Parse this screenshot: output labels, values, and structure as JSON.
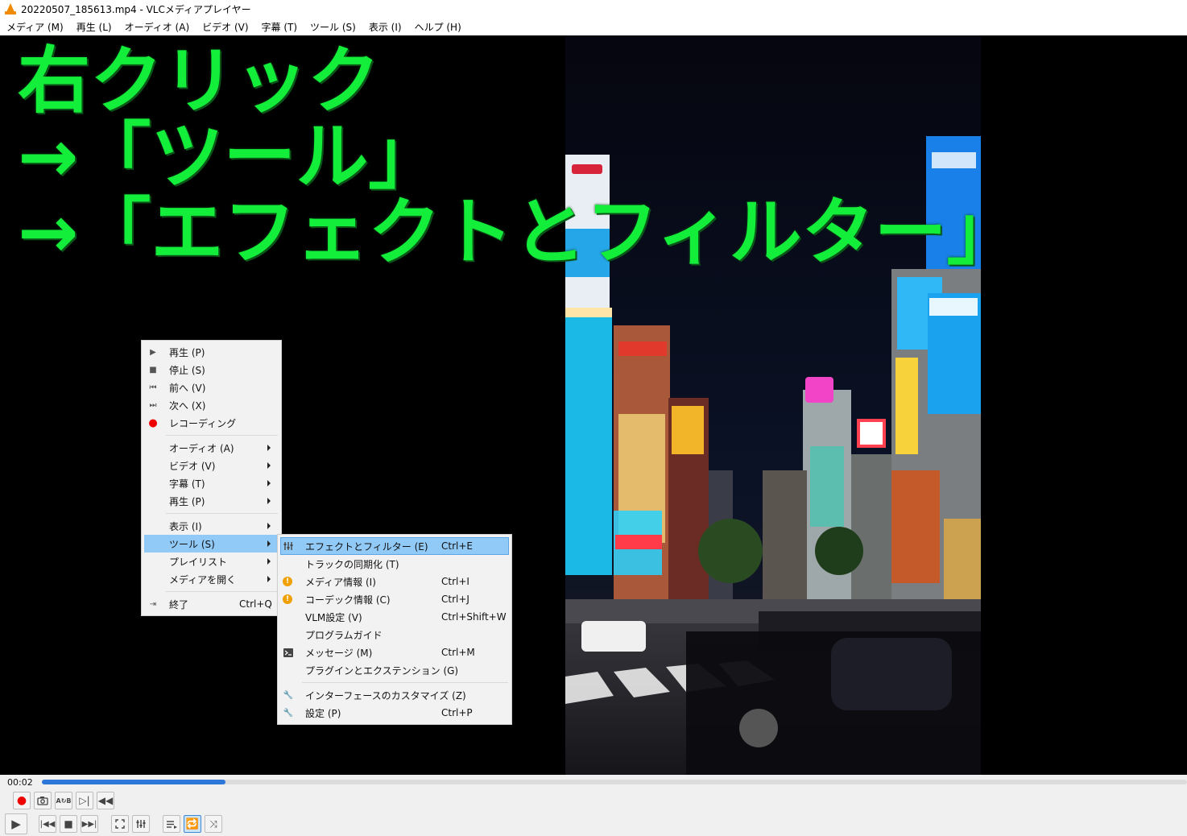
{
  "window": {
    "title": "20220507_185613.mp4 - VLCメディアプレイヤー"
  },
  "menubar": [
    {
      "label": "メディア (M)"
    },
    {
      "label": "再生 (L)"
    },
    {
      "label": "オーディオ (A)"
    },
    {
      "label": "ビデオ (V)"
    },
    {
      "label": "字幕 (T)"
    },
    {
      "label": "ツール (S)"
    },
    {
      "label": "表示 (I)"
    },
    {
      "label": "ヘルプ (H)"
    }
  ],
  "overlay": {
    "color": "#13ee3a",
    "lines": [
      "右クリック",
      "→「ツール」",
      "→「エフェクトとフィルター」"
    ]
  },
  "context_menu": {
    "items": [
      {
        "label": "再生 (P)",
        "icon": "play-icon"
      },
      {
        "label": "停止 (S)",
        "icon": "stop-icon"
      },
      {
        "label": "前へ (V)",
        "icon": "previous-icon"
      },
      {
        "label": "次へ (X)",
        "icon": "next-icon"
      },
      {
        "label": "レコーディング",
        "icon": "record-icon"
      },
      {
        "label": "オーディオ (A)",
        "submenu": true
      },
      {
        "label": "ビデオ (V)",
        "submenu": true
      },
      {
        "label": "字幕 (T)",
        "submenu": true
      },
      {
        "label": "再生 (P)",
        "submenu": true
      },
      {
        "label": "表示 (I)",
        "submenu": true
      },
      {
        "label": "ツール (S)",
        "submenu": true,
        "highlighted": true
      },
      {
        "label": "プレイリスト",
        "submenu": true
      },
      {
        "label": "メディアを開く",
        "submenu": true
      },
      {
        "label": "終了",
        "shortcut": "Ctrl+Q",
        "icon": "exit-icon"
      }
    ]
  },
  "tools_submenu": {
    "items": [
      {
        "label": "エフェクトとフィルター (E)",
        "shortcut": "Ctrl+E",
        "icon": "equalizer-icon",
        "highlighted": true
      },
      {
        "label": "トラックの同期化 (T)"
      },
      {
        "label": "メディア情報 (I)",
        "shortcut": "Ctrl+I",
        "icon": "info-icon"
      },
      {
        "label": "コーデック情報 (C)",
        "shortcut": "Ctrl+J",
        "icon": "info-icon"
      },
      {
        "label": "VLM設定 (V)",
        "shortcut": "Ctrl+Shift+W"
      },
      {
        "label": "プログラムガイド"
      },
      {
        "label": "メッセージ (M)",
        "shortcut": "Ctrl+M",
        "icon": "terminal-icon"
      },
      {
        "label": "プラグインとエクステンション (G)"
      },
      {
        "label": "インターフェースのカスタマイズ (Z)",
        "icon": "wrench-icon"
      },
      {
        "label": "設定 (P)",
        "shortcut": "Ctrl+P",
        "icon": "wrench-icon"
      }
    ]
  },
  "player": {
    "time_elapsed": "00:02",
    "progress_fraction": 0.16
  }
}
